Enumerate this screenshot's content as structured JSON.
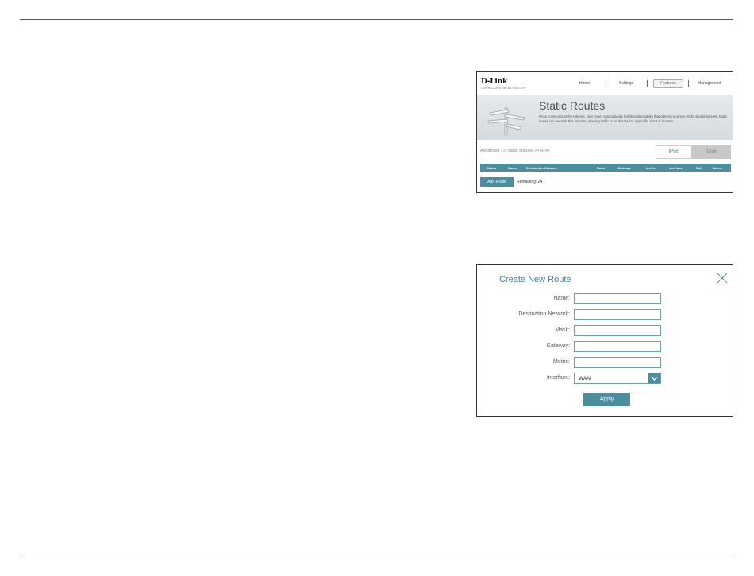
{
  "router_ui": {
    "brand": "D-Link",
    "model": "COVR-C1203 HW:A1 FW:1.00",
    "nav": {
      "home": "Home",
      "settings": "Settings",
      "features": "Features",
      "management": "Management"
    },
    "banner": {
      "title": "Static Routes",
      "description": "Once connected to the Internet, your router automatically builds routing tables that determine where traffic should be sent. Static routes can override this process, allowing traffic to be directed to a specific client or location."
    },
    "breadcrumb": "Advanced >> Static Routes >> IPv4",
    "ipv6_label": "IPv6",
    "save_label": "Save",
    "table_headers": [
      "Status",
      "Name",
      "Destination Network",
      "Mask",
      "Gateway",
      "Metric",
      "Interface",
      "Edit",
      "Delete"
    ],
    "add_route_label": "Add Route",
    "remaining_text": "Remaining: 24"
  },
  "dialog": {
    "title": "Create New Route",
    "fields": [
      {
        "label": "Name:",
        "value": ""
      },
      {
        "label": "Destination Network:",
        "value": ""
      },
      {
        "label": "Mask:",
        "value": ""
      },
      {
        "label": "Gateway:",
        "value": ""
      },
      {
        "label": "Metric:",
        "value": ""
      }
    ],
    "interface_label": "Interface:",
    "interface_value": "WAN",
    "apply_label": "Apply"
  },
  "colors": {
    "accent": "#4a8ea0",
    "title_teal": "#3d8597"
  },
  "icons": {
    "close": "close-icon",
    "dropdown": "chevron-down-icon",
    "banner": "signpost-icon"
  }
}
